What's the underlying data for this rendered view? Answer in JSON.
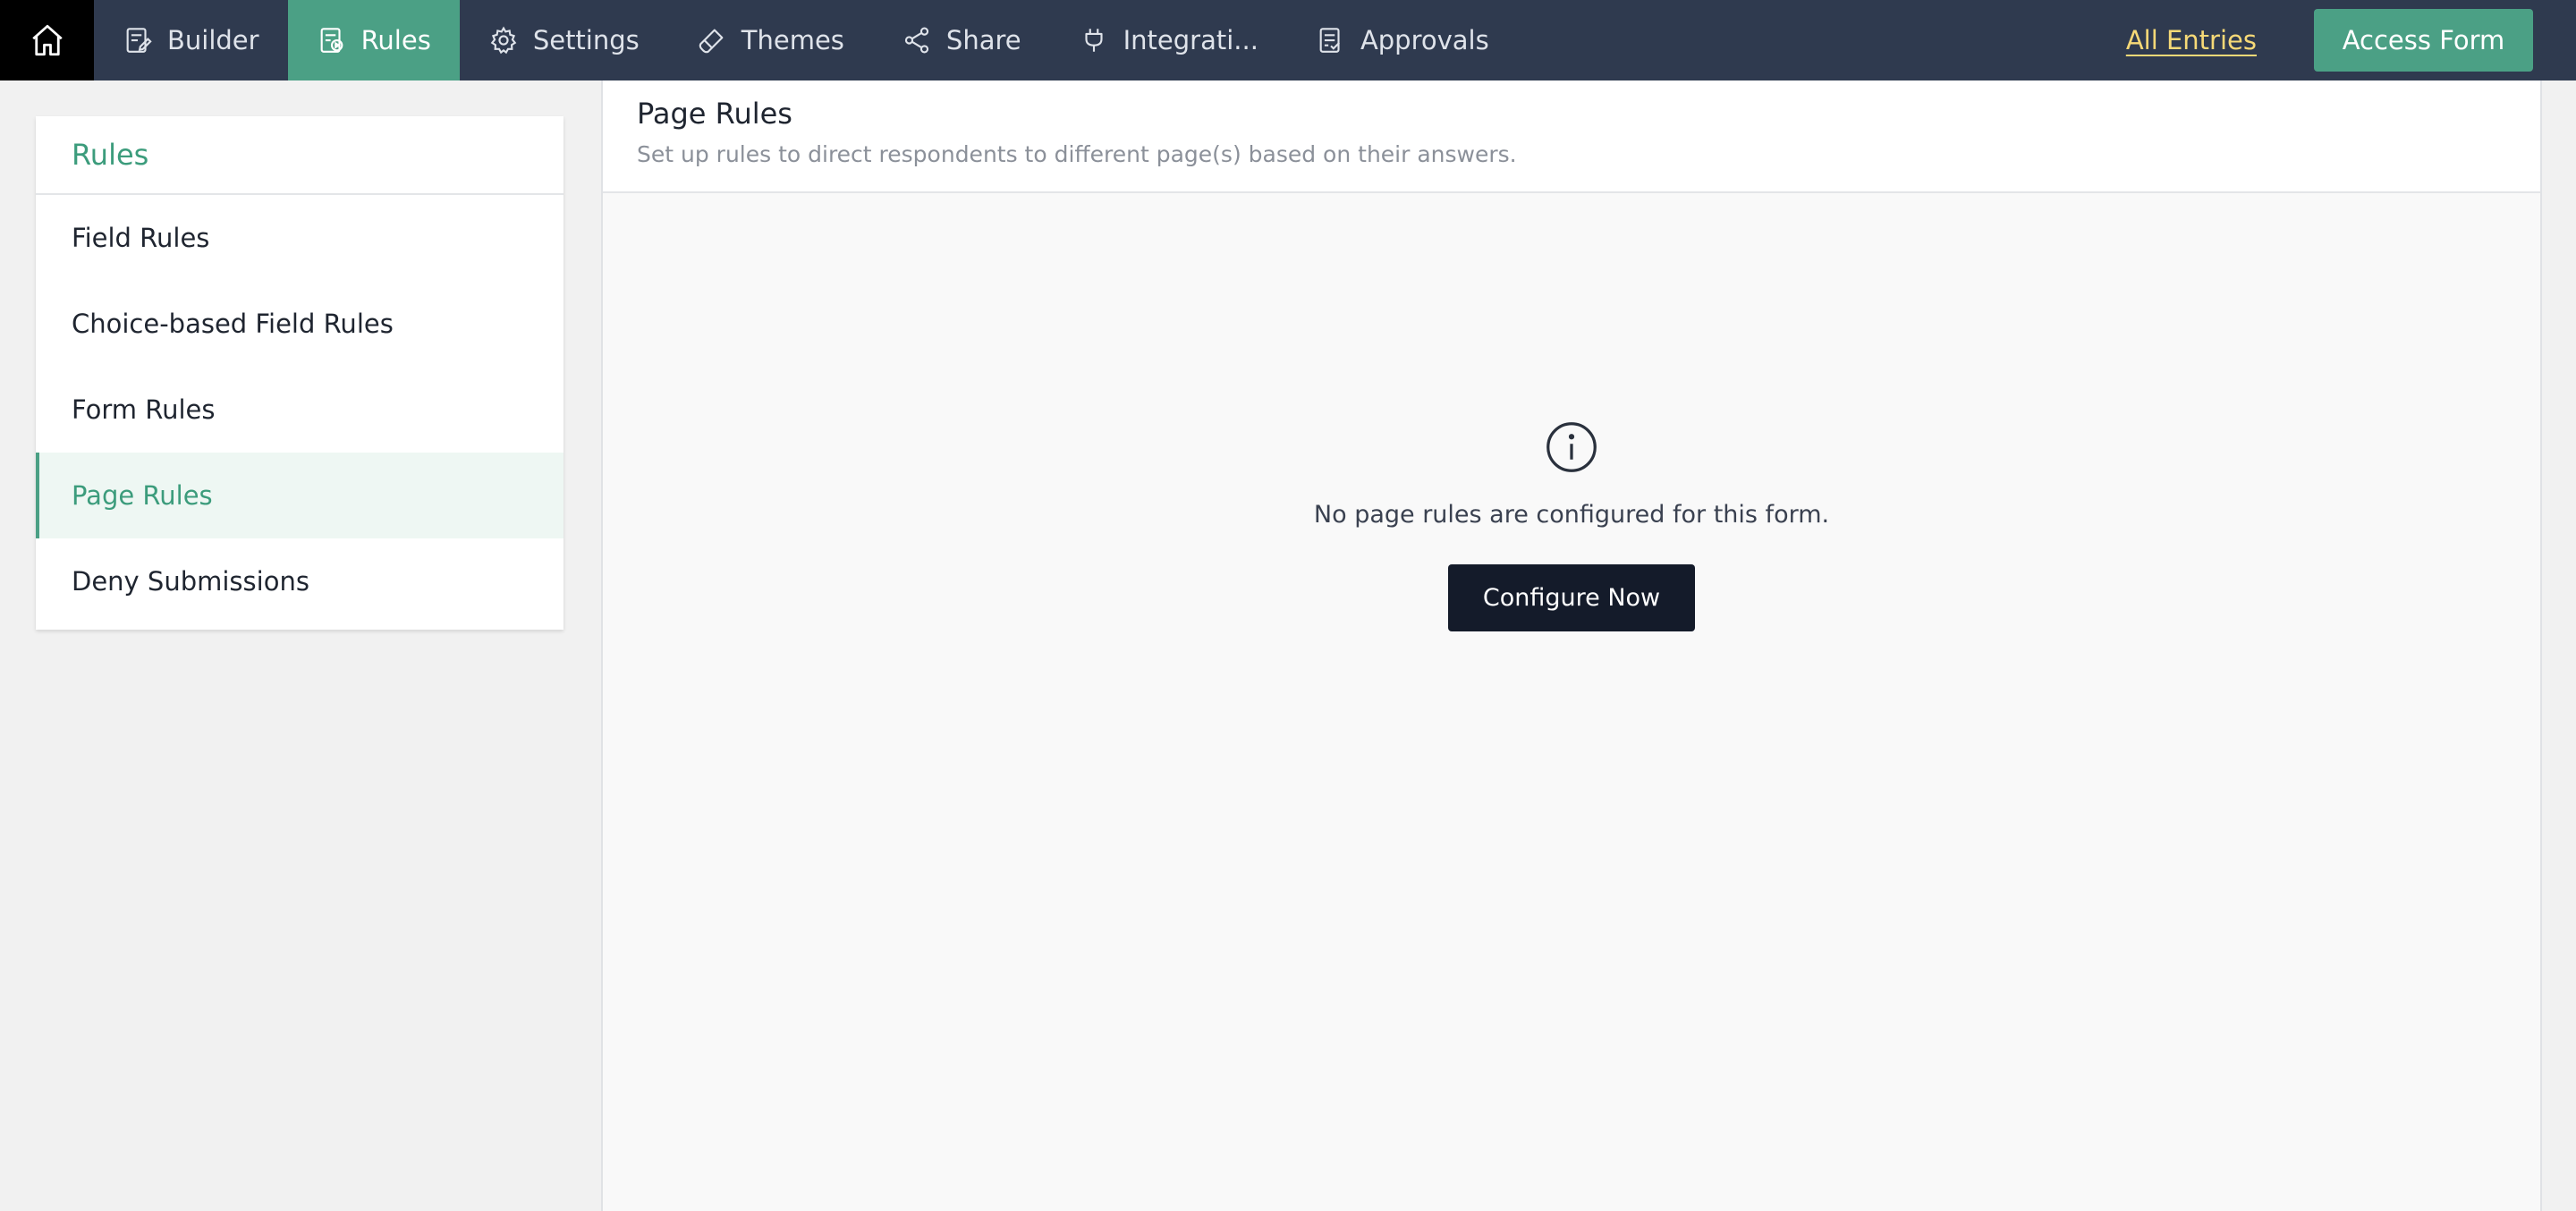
{
  "nav": {
    "home_icon": "home-icon",
    "tabs": [
      {
        "label": "Builder",
        "icon": "builder-icon"
      },
      {
        "label": "Rules",
        "icon": "rules-icon",
        "active": true
      },
      {
        "label": "Settings",
        "icon": "gear-icon"
      },
      {
        "label": "Themes",
        "icon": "brush-icon"
      },
      {
        "label": "Share",
        "icon": "share-icon"
      },
      {
        "label": "Integrati...",
        "icon": "plug-icon"
      },
      {
        "label": "Approvals",
        "icon": "approvals-icon"
      }
    ],
    "all_entries": "All Entries",
    "access_form": "Access Form"
  },
  "sidebar": {
    "title": "Rules",
    "items": [
      {
        "label": "Field Rules"
      },
      {
        "label": "Choice-based Field Rules"
      },
      {
        "label": "Form Rules"
      },
      {
        "label": "Page Rules",
        "active": true
      },
      {
        "label": "Deny Submissions"
      }
    ]
  },
  "main": {
    "title": "Page Rules",
    "subtitle": "Set up rules to direct respondents to different page(s) based on their answers.",
    "empty_message": "No page rules are configured for this form.",
    "configure_button": "Configure Now"
  },
  "colors": {
    "nav_bg": "#2f3a4f",
    "accent": "#4ba085",
    "link": "#f6d977",
    "button_dark": "#141b2a"
  }
}
